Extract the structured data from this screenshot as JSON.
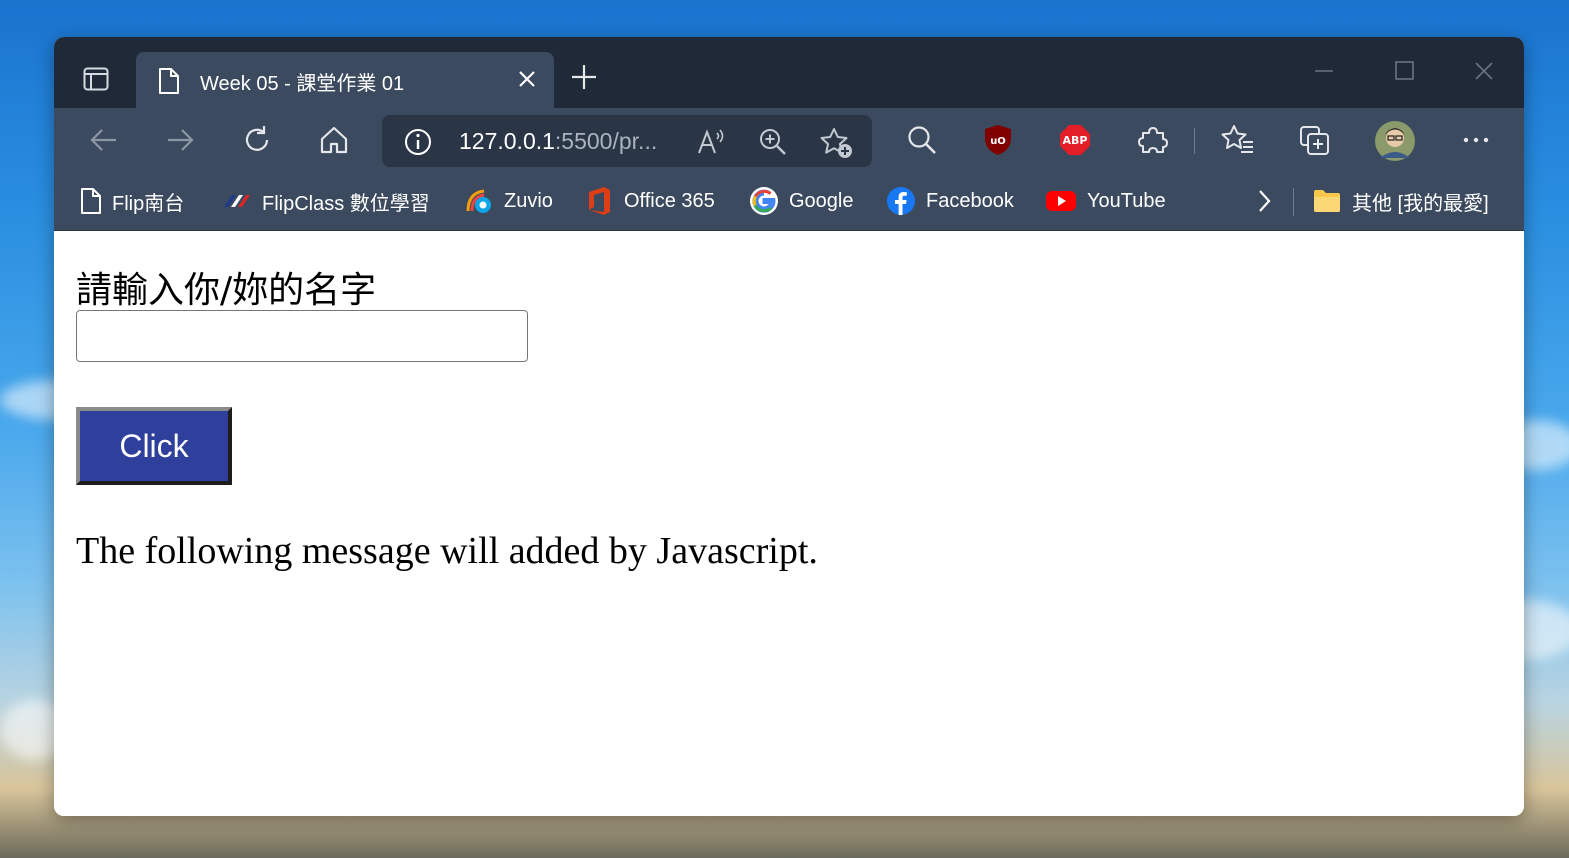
{
  "browser": {
    "tab": {
      "title": "Week 05 - 課堂作業 01"
    },
    "address": {
      "host": "127.0.0.1",
      "path": ":5500/pr..."
    },
    "bookmarks": [
      {
        "label": "Flip南台",
        "icon": "page-icon"
      },
      {
        "label": "FlipClass 數位學習",
        "icon": "flipclass-icon"
      },
      {
        "label": "Zuvio",
        "icon": "zuvio-icon"
      },
      {
        "label": "Office 365",
        "icon": "office-icon"
      },
      {
        "label": "Google",
        "icon": "google-icon"
      },
      {
        "label": "Facebook",
        "icon": "facebook-icon"
      },
      {
        "label": "YouTube",
        "icon": "youtube-icon"
      }
    ],
    "other_favorites": "其他 [我的最愛]"
  },
  "page": {
    "prompt_label": "請輸入你/妳的名字",
    "name_input_value": "",
    "click_button_label": "Click",
    "message": "The following message will added by Javascript."
  },
  "colors": {
    "tabstrip": "#1f2937",
    "toolbar": "#3b4a5e",
    "button": "#2f3f9c"
  }
}
